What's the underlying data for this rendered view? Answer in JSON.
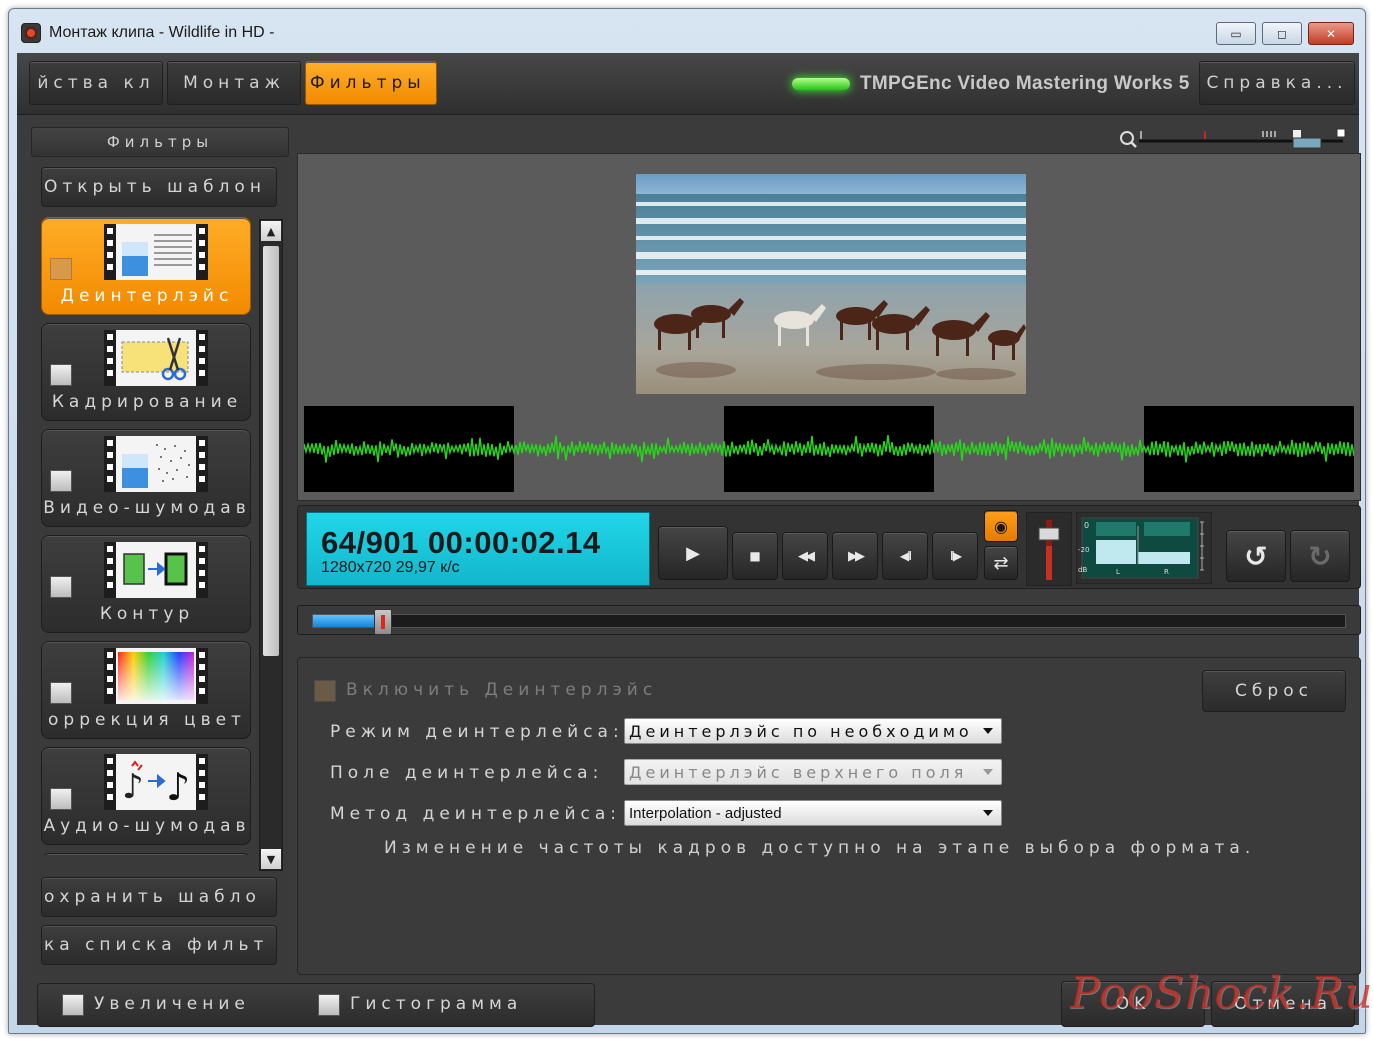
{
  "window": {
    "title": "Монтаж клипа - Wildlife in HD -",
    "min_symbol": "▭",
    "max_symbol": "◻",
    "close_symbol": "✕"
  },
  "tabs": {
    "props_label": "йства кл",
    "montage_label": "Монтаж",
    "filters_label": "Фильтры",
    "brand": "TMPGEnc Video Mastering Works 5",
    "help_label": "Справка..."
  },
  "left_panel": {
    "title": "Фильтры",
    "open_template": "Открыть шаблон",
    "save_template": "охранить шабло",
    "filter_list_btn": "ка списка фильт",
    "filters": [
      {
        "label": "Деинтерлэйс",
        "active": true
      },
      {
        "label": "Кадрирование",
        "active": false
      },
      {
        "label": "Видео-шумодав",
        "active": false
      },
      {
        "label": "Контур",
        "active": false
      },
      {
        "label": "оррекция цвет",
        "active": false
      },
      {
        "label": "Аудио-шумодав",
        "active": false
      }
    ],
    "scroll_up": "▲",
    "scroll_down": "▼"
  },
  "player": {
    "timecode": "64/901  00:00:02.14",
    "format": "1280x720 29,97 к/с",
    "seek_position": 0.068,
    "icons": {
      "play": "▶",
      "stop": "■",
      "rewind": "◀◀",
      "fast_forward": "▶▶",
      "prev_frame": "◀II",
      "next_frame": "II▶",
      "speaker": "◉",
      "loop": "⇄",
      "undo": "↺",
      "redo": "↻"
    },
    "meter_labels": {
      "top": "0",
      "mid": "-20",
      "unit": "dB",
      "left": "L",
      "right": "R"
    }
  },
  "settings": {
    "enable_label": "Включить Деинтерлэйс",
    "reset_label": "Сброс",
    "mode_label": "Режим деинтерлейса:",
    "mode_value": "Деинтерлэйс по необходимости",
    "field_label": "Поле деинтерлейса:",
    "field_value": "Деинтерлэйс верхнего поля",
    "method_label": "Метод деинтерлейса:",
    "method_value": "Interpolation - adjusted",
    "note": "Изменение частоты кадров доступно на этапе выбора формата."
  },
  "bottom": {
    "zoom_label": "Увеличение",
    "histogram_label": "Гистограмма",
    "ok_label": "OK",
    "cancel_label": "Отмена",
    "watermark": "PooShock.Ru"
  },
  "colors": {
    "accent_orange": "#f59100",
    "timecode_cyan": "#17c6da",
    "waveform_green": "#2bd21e"
  }
}
